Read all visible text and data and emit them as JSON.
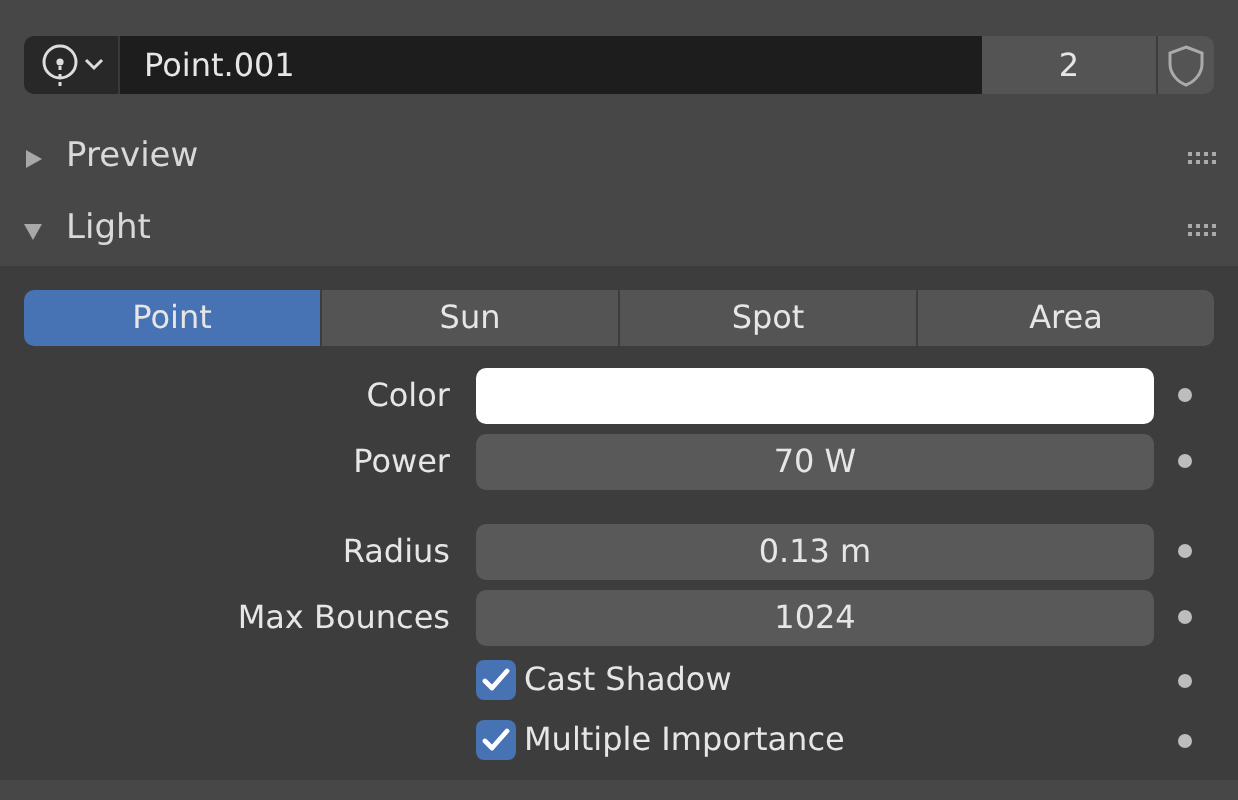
{
  "datablock": {
    "name": "Point.001",
    "users": "2"
  },
  "panels": [
    {
      "title": "Preview",
      "expanded": false
    },
    {
      "title": "Light",
      "expanded": true
    }
  ],
  "light_types": [
    {
      "label": "Point",
      "selected": true
    },
    {
      "label": "Sun",
      "selected": false
    },
    {
      "label": "Spot",
      "selected": false
    },
    {
      "label": "Area",
      "selected": false
    }
  ],
  "property_groups": [
    [
      {
        "kind": "color",
        "label": "Color",
        "color": "#ffffff"
      },
      {
        "kind": "number",
        "label": "Power",
        "value": "70 W"
      }
    ],
    [
      {
        "kind": "number",
        "label": "Radius",
        "value": "0.13 m"
      },
      {
        "kind": "number",
        "label": "Max Bounces",
        "value": "1024"
      },
      {
        "kind": "checkbox",
        "label": "Cast Shadow",
        "checked": true
      },
      {
        "kind": "checkbox",
        "label": "Multiple Importance",
        "checked": true
      }
    ]
  ]
}
